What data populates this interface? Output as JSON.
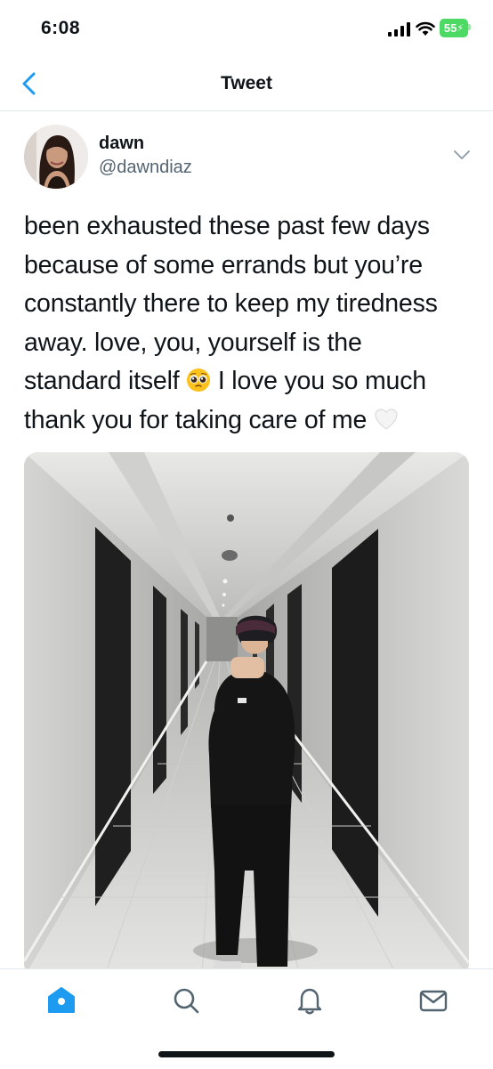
{
  "status_bar": {
    "time": "6:08",
    "battery_level": "55",
    "icons": [
      "signal-icon",
      "wifi-icon",
      "battery-charging-icon"
    ]
  },
  "nav": {
    "title": "Tweet",
    "back_icon": "chevron-left-icon"
  },
  "tweet": {
    "author": {
      "display_name": "dawn",
      "handle": "@dawndiaz"
    },
    "lines": [
      "been exhausted these past few days",
      "because of some errands but you’re",
      "constantly there to keep my tiredness",
      "away. love, you, yourself is the",
      "standard itself",
      "I love you so much",
      "thank you for taking care of me"
    ],
    "emojis": [
      "pleading-face-emoji",
      "white-heart-emoji"
    ],
    "more_icon": "chevron-down-icon"
  },
  "tab_bar": {
    "tabs": [
      "home-icon",
      "search-icon",
      "notifications-bell-icon",
      "messages-envelope-icon"
    ],
    "active": "home-icon"
  },
  "colors": {
    "accent": "#1d9bf0",
    "text": "#0f1419",
    "secondary_text": "#536471",
    "battery": "#4cd964",
    "divider": "#e1e8ed"
  }
}
